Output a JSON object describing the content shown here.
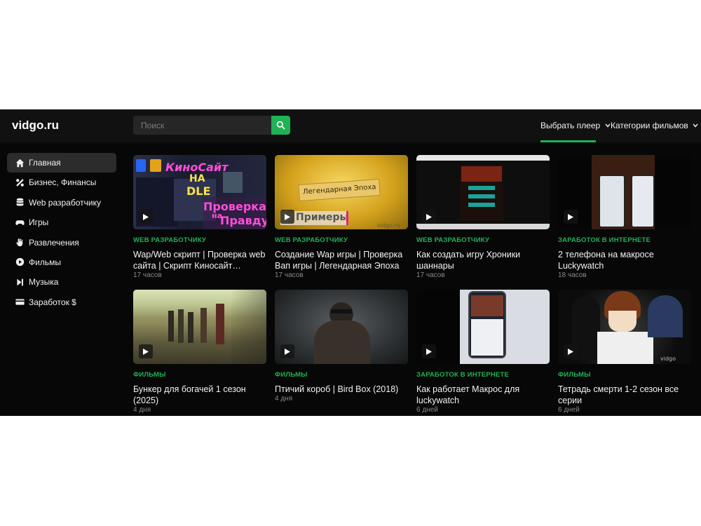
{
  "header": {
    "logo": "vidgo.ru",
    "search_placeholder": "Поиск",
    "nav": [
      {
        "label": "Выбрать плеер"
      },
      {
        "label": "Категории фильмов"
      }
    ]
  },
  "sidebar": {
    "items": [
      {
        "label": "Главная",
        "icon": "home-icon"
      },
      {
        "label": "Бизнес, Финансы",
        "icon": "percent-icon"
      },
      {
        "label": "Web разработчику",
        "icon": "database-icon"
      },
      {
        "label": "Игры",
        "icon": "gamepad-icon"
      },
      {
        "label": "Развлечения",
        "icon": "hand-icon"
      },
      {
        "label": "Фильмы",
        "icon": "play-circle-icon"
      },
      {
        "label": "Музыка",
        "icon": "skip-icon"
      },
      {
        "label": "Заработок $",
        "icon": "card-icon"
      }
    ]
  },
  "videos": [
    {
      "category": "WEB РАЗРАБОТЧИКУ",
      "title": "Wap/Web скрипт | Проверка web сайта | Скрипт Киносайт…",
      "time": "17 часов",
      "thumb_text": [
        "КиноСайт",
        "НА",
        "DLE",
        "Проверка",
        "на",
        "Правду"
      ]
    },
    {
      "category": "WEB РАЗРАБОТЧИКУ",
      "title": "Создание Wap игры | Проверка Вап игры | Легендарная Эпоха",
      "time": "17 часов",
      "thumb_text": [
        "Легендарная Эпоха",
        "Примеры",
        "vidgo.ru"
      ]
    },
    {
      "category": "WEB РАЗРАБОТЧИКУ",
      "title": "Как создать игру Хроники шаннары",
      "time": "17 часов"
    },
    {
      "category": "ЗАРАБОТОК В ИНТЕРНЕТЕ",
      "title": "2 телефона на макросе Luckywatch",
      "time": "18 часов"
    },
    {
      "category": "ФИЛЬМЫ",
      "title": "Бункер для богачей 1 сезон (2025)",
      "time": "4 дня"
    },
    {
      "category": "ФИЛЬМЫ",
      "title": "Птичий короб | Bird Box (2018)",
      "time": "4 дня"
    },
    {
      "category": "ЗАРАБОТОК В ИНТЕРНЕТЕ",
      "title": "Как работает Макрос для luckywatch",
      "time": "6 дней"
    },
    {
      "category": "ФИЛЬМЫ",
      "title": "Тетрадь смерти 1-2 сезон все серии",
      "time": "6 дней",
      "thumb_text": [
        "vidgo"
      ]
    }
  ],
  "colors": {
    "accent": "#1fb355",
    "background": "#070707",
    "header": "#111111"
  }
}
